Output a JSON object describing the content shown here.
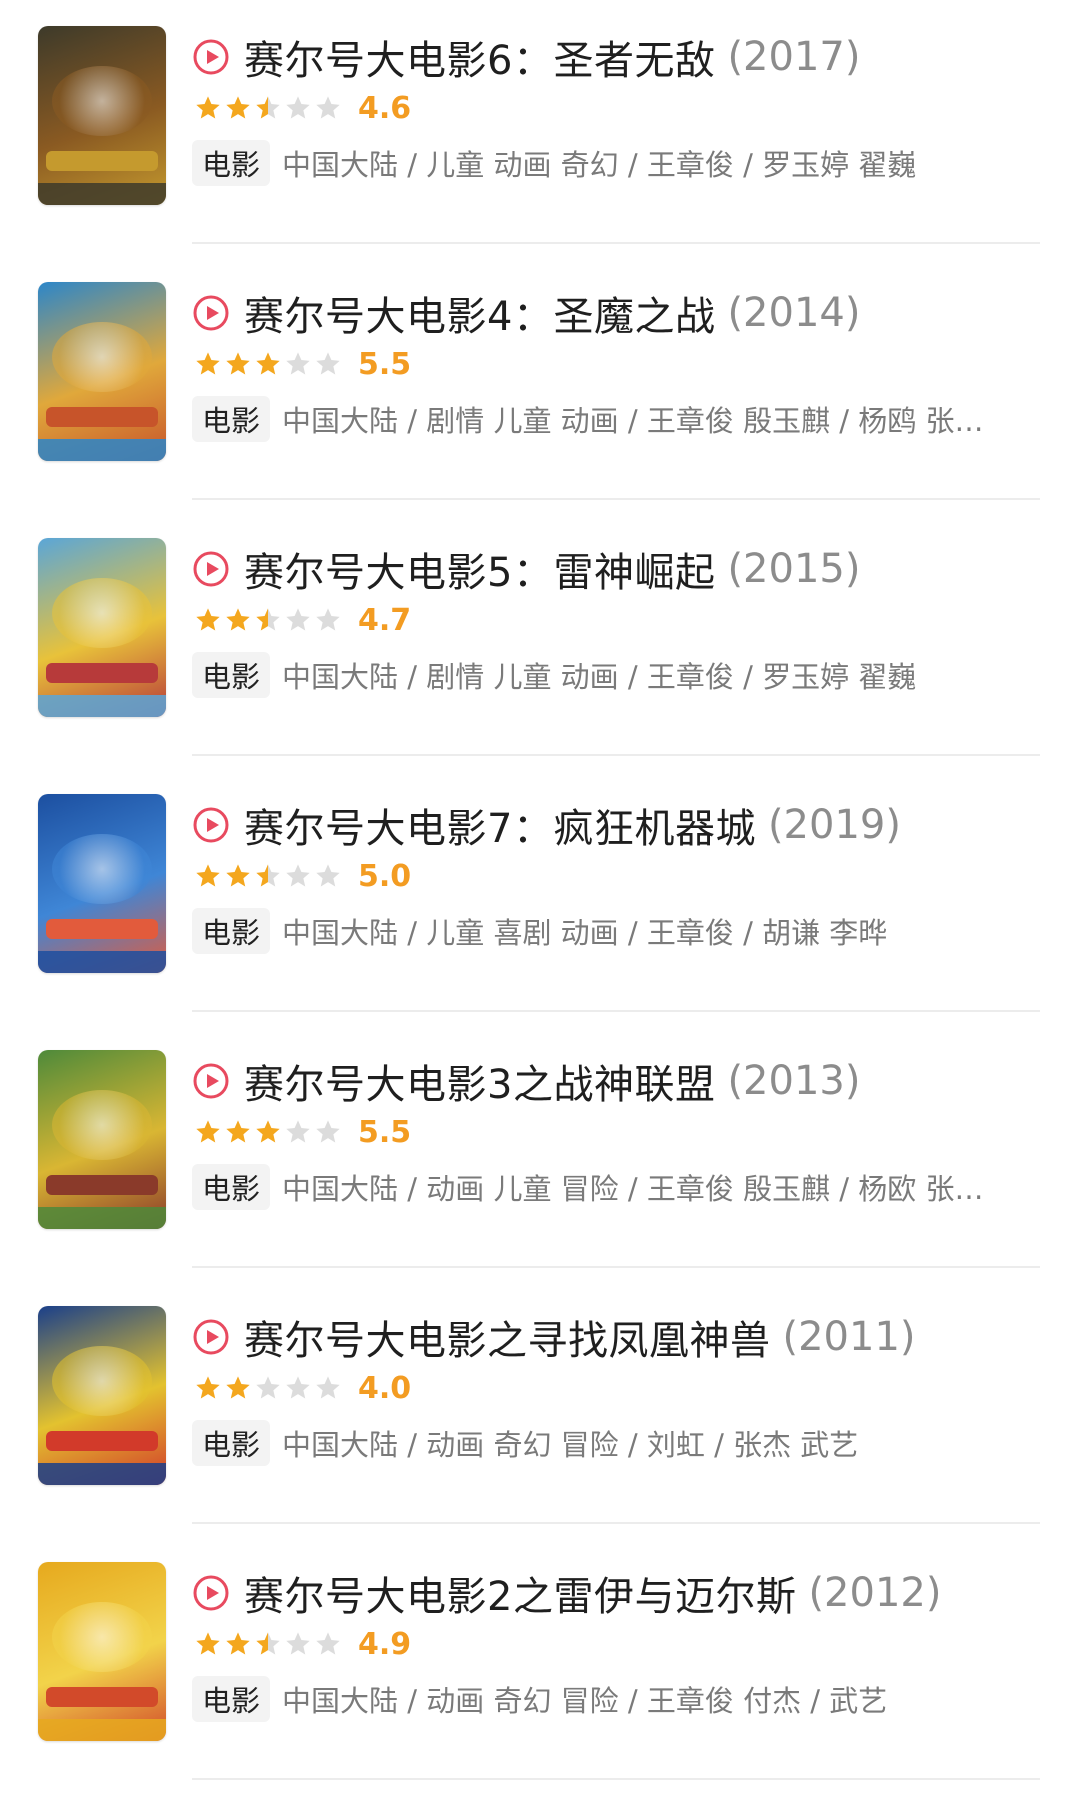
{
  "colors": {
    "play_icon": "#e84a5f",
    "star_filled": "#f4a71e",
    "star_empty": "#dcdcdc",
    "score": "#f39c22",
    "year": "#8c8c8c",
    "tag_bg": "#f3f3f3"
  },
  "icons": {
    "play": "play-circle-icon",
    "star": "star-icon"
  },
  "movies": [
    {
      "title": "赛尔号大电影6：圣者无敌",
      "year": "(2017)",
      "stars": 2.5,
      "score": "4.6",
      "tag": "电影",
      "meta": "中国大陆 / 儿童 动画 奇幻 / 王章俊 / 罗玉婷 翟巍",
      "poster_colors": [
        "#3d3a2a",
        "#8a5a22",
        "#c59a2e"
      ]
    },
    {
      "title": "赛尔号大电影4：圣魔之战",
      "year": "(2014)",
      "stars": 3,
      "score": "5.5",
      "tag": "电影",
      "meta": "中国大陆 / 剧情 儿童 动画 / 王章俊 殷玉麒 / 杨鸥 张…",
      "poster_colors": [
        "#2c86c9",
        "#e0a83b",
        "#c7542a"
      ]
    },
    {
      "title": "赛尔号大电影5：雷神崛起",
      "year": "(2015)",
      "stars": 2.5,
      "score": "4.7",
      "tag": "电影",
      "meta": "中国大陆 / 剧情 儿童 动画 / 王章俊 / 罗玉婷 翟巍",
      "poster_colors": [
        "#5aa6d8",
        "#e8c23a",
        "#b73a3a"
      ]
    },
    {
      "title": "赛尔号大电影7：疯狂机器城",
      "year": "(2019)",
      "stars": 2.5,
      "score": "5.0",
      "tag": "电影",
      "meta": "中国大陆 / 儿童 喜剧 动画 / 王章俊 / 胡谦 李晔",
      "poster_colors": [
        "#1c4fa0",
        "#3f86d6",
        "#e25b3c"
      ]
    },
    {
      "title": "赛尔号大电影3之战神联盟",
      "year": "(2013)",
      "stars": 3,
      "score": "5.5",
      "tag": "电影",
      "meta": "中国大陆 / 动画 儿童 冒险 / 王章俊 殷玉麒 / 杨欧 张…",
      "poster_colors": [
        "#4e8a3a",
        "#d9b633",
        "#8a3a2a"
      ]
    },
    {
      "title": "赛尔号大电影之寻找凤凰神兽",
      "year": "(2011)",
      "stars": 2,
      "score": "4.0",
      "tag": "电影",
      "meta": "中国大陆 / 动画 奇幻 冒险 / 刘虹 / 张杰 武艺",
      "poster_colors": [
        "#1a3f8a",
        "#e3c22f",
        "#d23a2a"
      ]
    },
    {
      "title": "赛尔号大电影2之雷伊与迈尔斯",
      "year": "(2012)",
      "stars": 2.5,
      "score": "4.9",
      "tag": "电影",
      "meta": "中国大陆 / 动画 奇幻 冒险 / 王章俊 付杰 / 武艺",
      "poster_colors": [
        "#e6a91e",
        "#f2d34a",
        "#d24a2a"
      ]
    }
  ]
}
